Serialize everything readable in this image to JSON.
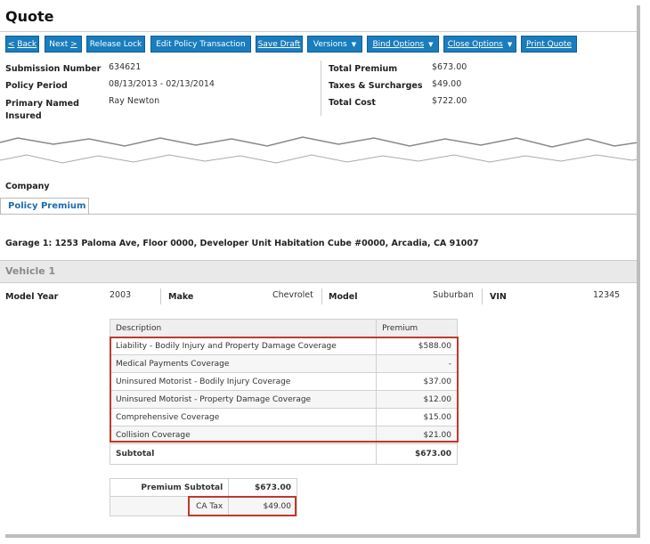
{
  "page_title": "Quote",
  "toolbar": {
    "back": "Back",
    "next": "Next",
    "release_lock": "Release Lock",
    "edit_policy_transaction": "Edit Policy Transaction",
    "save_draft": "Save Draft",
    "versions": "Versions",
    "bind_options": "Bind Options",
    "close_options": "Close Options",
    "print_quote": "Print Quote"
  },
  "summary_left": [
    {
      "label": "Submission Number",
      "value": "634621"
    },
    {
      "label": "Policy Period",
      "value": "08/13/2013 - 02/13/2014"
    },
    {
      "label": "Primary Named Insured",
      "value": "Ray Newton"
    }
  ],
  "summary_right": [
    {
      "label": "Total Premium",
      "value": "$673.00"
    },
    {
      "label": "Taxes & Surcharges",
      "value": "$49.00"
    },
    {
      "label": "Total Cost",
      "value": "$722.00"
    }
  ],
  "company_label": "Company",
  "tabs": [
    "Policy Premium"
  ],
  "garage_text": "Garage 1: 1253 Paloma Ave, Floor 0000, Developer Unit Habitation Cube #0000, Arcadia, CA 91007",
  "vehicle": {
    "title": "Vehicle 1",
    "model_year_label": "Model Year",
    "model_year": "2003",
    "make_label": "Make",
    "make": "Chevrolet",
    "model_label": "Model",
    "model": "Suburban",
    "vin_label": "VIN",
    "vin": "12345"
  },
  "coverage_table": {
    "headers": [
      "Description",
      "Premium"
    ],
    "rows": [
      {
        "description": "Liability - Bodily Injury and Property Damage Coverage",
        "premium": "$588.00"
      },
      {
        "description": "Medical Payments Coverage",
        "premium": "-"
      },
      {
        "description": "Uninsured Motorist - Bodily Injury Coverage",
        "premium": "$37.00"
      },
      {
        "description": "Uninsured Motorist - Property Damage Coverage",
        "premium": "$12.00"
      },
      {
        "description": "Comprehensive Coverage",
        "premium": "$15.00"
      },
      {
        "description": "Collision Coverage",
        "premium": "$21.00"
      }
    ],
    "subtotal_label": "Subtotal",
    "subtotal_value": "$673.00"
  },
  "premium_summary": {
    "premium_subtotal_label": "Premium Subtotal",
    "premium_subtotal_value": "$673.00",
    "tax_label": "CA Tax",
    "tax_value": "$49.00"
  },
  "colors": {
    "button_blue": "#1a7dbd",
    "highlight_red": "#c0392b",
    "tab_text": "#1a6bb0"
  }
}
